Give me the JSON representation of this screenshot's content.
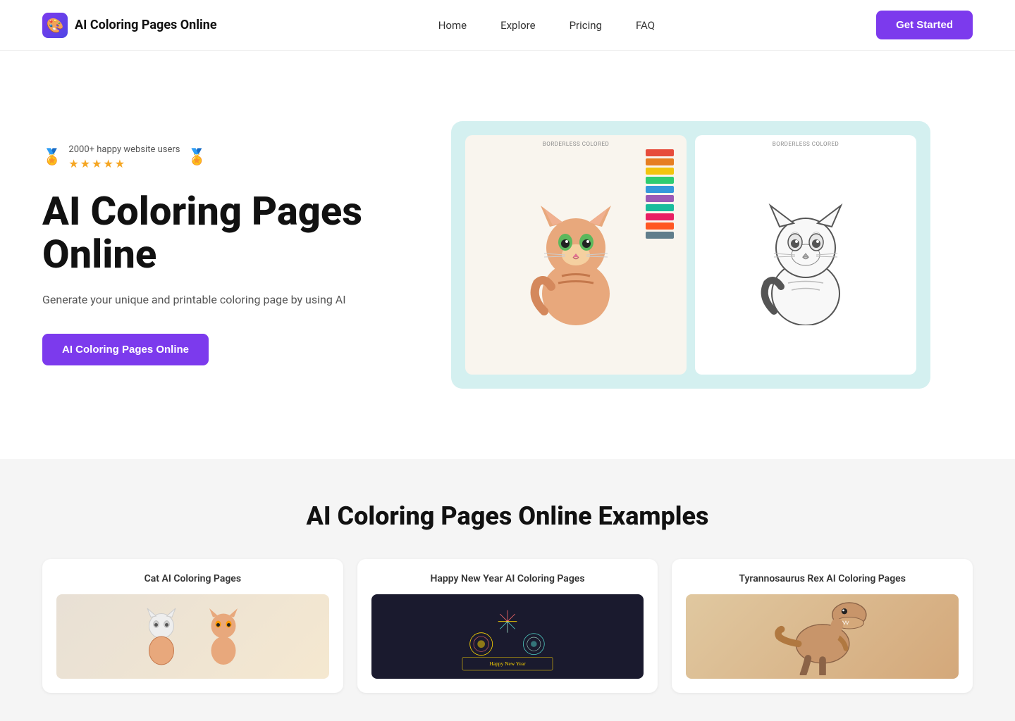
{
  "nav": {
    "logo_text": "AI Coloring Pages Online",
    "links": [
      {
        "label": "Home",
        "href": "#"
      },
      {
        "label": "Explore",
        "href": "#"
      },
      {
        "label": "Pricing",
        "href": "#"
      },
      {
        "label": "FAQ",
        "href": "#"
      }
    ],
    "cta_label": "Get Started"
  },
  "hero": {
    "social_proof_text": "2000+ happy website users",
    "stars": [
      "★",
      "★",
      "★",
      "★",
      "★"
    ],
    "title": "AI Coloring Pages Online",
    "description": "Generate your unique and printable coloring page by using AI",
    "cta_label": "AI Coloring Pages Online",
    "image_label_left": "BORDERLESS COLORED",
    "image_label_right": "BORDERLESS COLORED"
  },
  "examples": {
    "section_title": "AI Coloring Pages Online Examples",
    "cards": [
      {
        "title": "Cat AI Coloring Pages"
      },
      {
        "title": "Happy New Year AI Coloring Pages"
      },
      {
        "title": "Tyrannosaurus Rex AI Coloring Pages"
      }
    ]
  }
}
